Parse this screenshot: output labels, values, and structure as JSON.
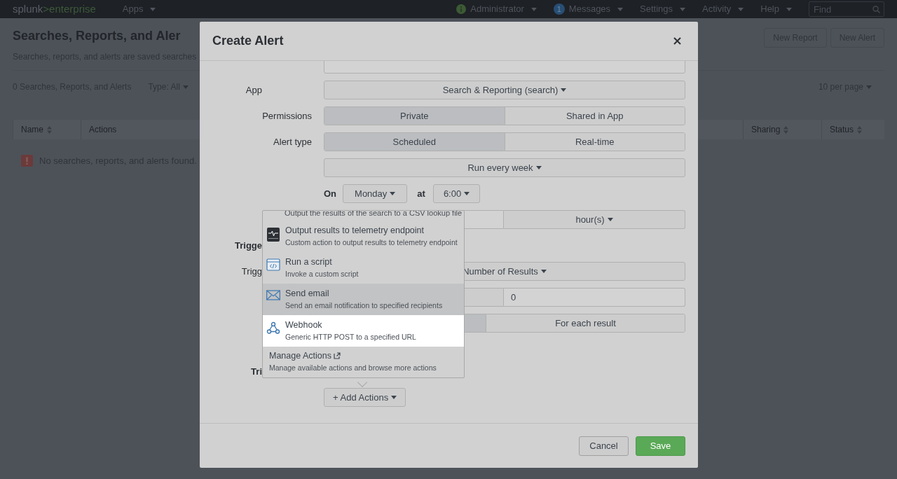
{
  "top_bar": {
    "logo_brand": "splunk",
    "logo_product": ">enterprise",
    "menus": [
      {
        "kind": "menu",
        "label": "Apps"
      }
    ],
    "right_menus": [
      {
        "kind": "status",
        "label": "Administrator"
      },
      {
        "kind": "badge",
        "badge": "1",
        "label": "Messages"
      },
      {
        "kind": "menu",
        "label": "Settings"
      },
      {
        "kind": "menu",
        "label": "Activity"
      },
      {
        "kind": "menu",
        "label": "Help"
      }
    ],
    "search": {
      "placeholder": "Find"
    }
  },
  "page": {
    "title": "Searches, Reports, and Aler",
    "subtitle": "Searches, reports, and alerts are saved searches",
    "buttons": [
      "New Report",
      "New Alert"
    ],
    "count": "0 Searches, Reports, and Alerts",
    "type_filter": "Type: All",
    "per_page": "10 per page",
    "table": {
      "columns": [
        {
          "label": "Name",
          "sortable": true
        },
        {
          "label": "Actions",
          "sortable": false
        },
        {
          "label": "Sharing",
          "sortable": true
        },
        {
          "label": "Status",
          "sortable": true
        }
      ],
      "empty_message": "No searches, reports, and alerts found."
    }
  },
  "modal": {
    "title": "Create Alert",
    "rows": [
      {
        "kind": "text"
      },
      {
        "kind": "select",
        "label": "App",
        "value": "Search & Reporting (search)"
      },
      {
        "kind": "segmented",
        "label": "Permissions",
        "options": [
          {
            "label": "Private",
            "selected": true
          },
          {
            "label": "Shared in App",
            "selected": false
          }
        ]
      },
      {
        "kind": "segmented",
        "label": "Alert type",
        "options": [
          {
            "label": "Scheduled",
            "selected": true
          },
          {
            "label": "Real-time",
            "selected": false
          }
        ]
      },
      {
        "kind": "select",
        "value": "Run every week"
      },
      {
        "kind": "schedule",
        "on_label": "On",
        "day": "Monday",
        "at_label": "at",
        "time": "6:00"
      },
      {
        "kind": "field_unit",
        "unit": "hour(s)"
      },
      {
        "kind": "heading",
        "label": "Trigge"
      },
      {
        "kind": "select",
        "label": "Trigg",
        "value": "Number of Results"
      },
      {
        "kind": "field_pair",
        "value": "0"
      },
      {
        "kind": "segmented",
        "options": [
          {
            "selected": true
          },
          {
            "label": "For each result",
            "selected": false
          }
        ]
      },
      {
        "kind": "spacer"
      },
      {
        "kind": "heading",
        "label": "Tri"
      },
      {
        "kind": "add_actions",
        "label": "+ Add Actions"
      }
    ],
    "menu": {
      "partial_description": "Output the results of the search to a CSV lookup file",
      "items": [
        {
          "title": "Output results to telemetry endpoint",
          "description": "Custom action to output results to telemetry endpoint",
          "hovered": false,
          "selected": false
        },
        {
          "title": "Run a script",
          "description": "Invoke a custom script",
          "hovered": false,
          "selected": false
        },
        {
          "title": "Send email",
          "description": "Send an email notification to specified recipients",
          "hovered": true,
          "selected": false
        },
        {
          "title": "Webhook",
          "description": "Generic HTTP POST to a specified URL",
          "hovered": false,
          "selected": true
        }
      ],
      "manage": {
        "title": "Manage Actions",
        "description": "Manage available actions and browse more actions"
      }
    },
    "buttons": [
      {
        "kind": "secondary",
        "label": "Cancel"
      },
      {
        "kind": "primary",
        "label": "Save"
      }
    ]
  }
}
